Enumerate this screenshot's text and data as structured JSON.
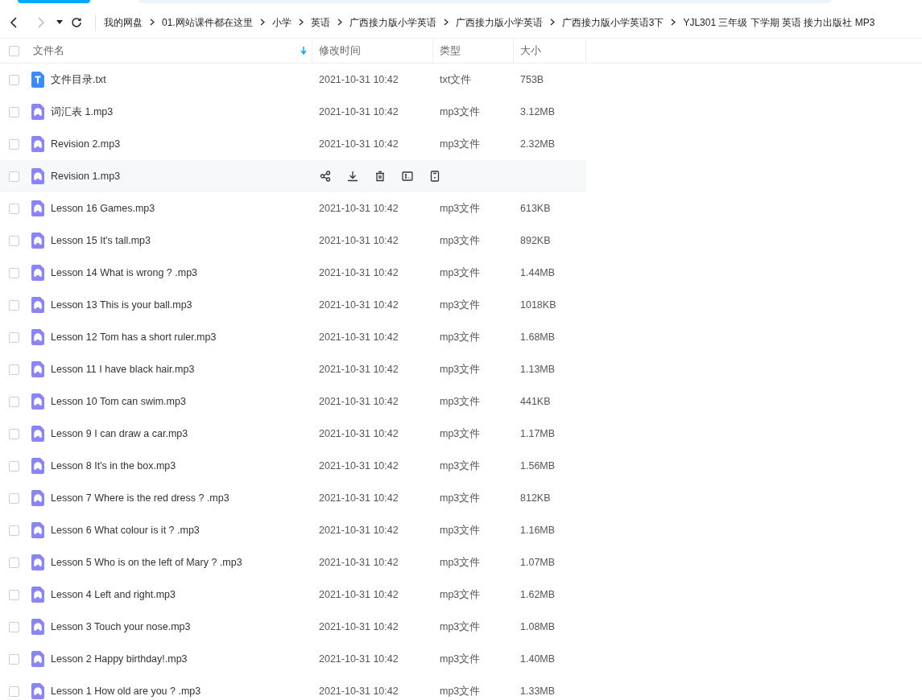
{
  "breadcrumb": [
    "我的网盘",
    "01.网站课件都在这里",
    "小学",
    "英语",
    "广西接力版小学英语",
    "广西接力版小学英语",
    "广西接力版小学英语3下",
    "YJL301 三年级 下学期 英语 接力出版社 MP3"
  ],
  "table": {
    "all_selected": false,
    "columns": [
      {
        "label": "文件名",
        "sorted": true
      },
      {
        "label": "修改时间",
        "sorted": false
      },
      {
        "label": "类型",
        "sorted": false
      },
      {
        "label": "大小",
        "sorted": false
      }
    ],
    "rows": [
      {
        "kind": "txt",
        "name": "文件目录.txt",
        "modified": "2021-10-31 10:42",
        "type": "txt文件",
        "size": "753B",
        "hovered": false,
        "checked": false
      },
      {
        "kind": "audio",
        "name": "词汇表 1.mp3",
        "modified": "2021-10-31 10:42",
        "type": "mp3文件",
        "size": "3.12MB",
        "hovered": false,
        "checked": false
      },
      {
        "kind": "audio",
        "name": "Revision 2.mp3",
        "modified": "2021-10-31 10:42",
        "type": "mp3文件",
        "size": "2.32MB",
        "hovered": false,
        "checked": false
      },
      {
        "kind": "audio",
        "name": "Revision 1.mp3",
        "hovered": true,
        "checked": false
      },
      {
        "kind": "audio",
        "name": "Lesson 16 Games.mp3",
        "modified": "2021-10-31 10:42",
        "type": "mp3文件",
        "size": "613KB",
        "hovered": false,
        "checked": false
      },
      {
        "kind": "audio",
        "name": "Lesson 15 It's tall.mp3",
        "modified": "2021-10-31 10:42",
        "type": "mp3文件",
        "size": "892KB",
        "hovered": false,
        "checked": false
      },
      {
        "kind": "audio",
        "name": "Lesson 14 What is wrong ? .mp3",
        "modified": "2021-10-31 10:42",
        "type": "mp3文件",
        "size": "1.44MB",
        "hovered": false,
        "checked": false
      },
      {
        "kind": "audio",
        "name": "Lesson 13 This is your ball.mp3",
        "modified": "2021-10-31 10:42",
        "type": "mp3文件",
        "size": "1018KB",
        "hovered": false,
        "checked": false
      },
      {
        "kind": "audio",
        "name": "Lesson 12 Tom has a short ruler.mp3",
        "modified": "2021-10-31 10:42",
        "type": "mp3文件",
        "size": "1.68MB",
        "hovered": false,
        "checked": false
      },
      {
        "kind": "audio",
        "name": "Lesson 11 I have black hair.mp3",
        "modified": "2021-10-31 10:42",
        "type": "mp3文件",
        "size": "1.13MB",
        "hovered": false,
        "checked": false
      },
      {
        "kind": "audio",
        "name": "Lesson 10 Tom can swim.mp3",
        "modified": "2021-10-31 10:42",
        "type": "mp3文件",
        "size": "441KB",
        "hovered": false,
        "checked": false
      },
      {
        "kind": "audio",
        "name": "Lesson 9 I can draw a car.mp3",
        "modified": "2021-10-31 10:42",
        "type": "mp3文件",
        "size": "1.17MB",
        "hovered": false,
        "checked": false
      },
      {
        "kind": "audio",
        "name": "Lesson 8 It's in the box.mp3",
        "modified": "2021-10-31 10:42",
        "type": "mp3文件",
        "size": "1.56MB",
        "hovered": false,
        "checked": false
      },
      {
        "kind": "audio",
        "name": "Lesson 7 Where is the red dress ? .mp3",
        "modified": "2021-10-31 10:42",
        "type": "mp3文件",
        "size": "812KB",
        "hovered": false,
        "checked": false
      },
      {
        "kind": "audio",
        "name": "Lesson 6 What colour is it ? .mp3",
        "modified": "2021-10-31 10:42",
        "type": "mp3文件",
        "size": "1.16MB",
        "hovered": false,
        "checked": false
      },
      {
        "kind": "audio",
        "name": "Lesson 5 Who is on the left of Mary ? .mp3",
        "modified": "2021-10-31 10:42",
        "type": "mp3文件",
        "size": "1.07MB",
        "hovered": false,
        "checked": false
      },
      {
        "kind": "audio",
        "name": "Lesson 4 Left and right.mp3",
        "modified": "2021-10-31 10:42",
        "type": "mp3文件",
        "size": "1.62MB",
        "hovered": false,
        "checked": false
      },
      {
        "kind": "audio",
        "name": "Lesson 3 Touch your nose.mp3",
        "modified": "2021-10-31 10:42",
        "type": "mp3文件",
        "size": "1.08MB",
        "hovered": false,
        "checked": false
      },
      {
        "kind": "audio",
        "name": "Lesson 2 Happy birthday!.mp3",
        "modified": "2021-10-31 10:42",
        "type": "mp3文件",
        "size": "1.40MB",
        "hovered": false,
        "checked": false
      },
      {
        "kind": "audio",
        "name": "Lesson 1 How old are you ? .mp3",
        "modified": "2021-10-31 10:42",
        "type": "mp3文件",
        "size": "1.33MB",
        "hovered": false,
        "checked": false
      }
    ]
  }
}
